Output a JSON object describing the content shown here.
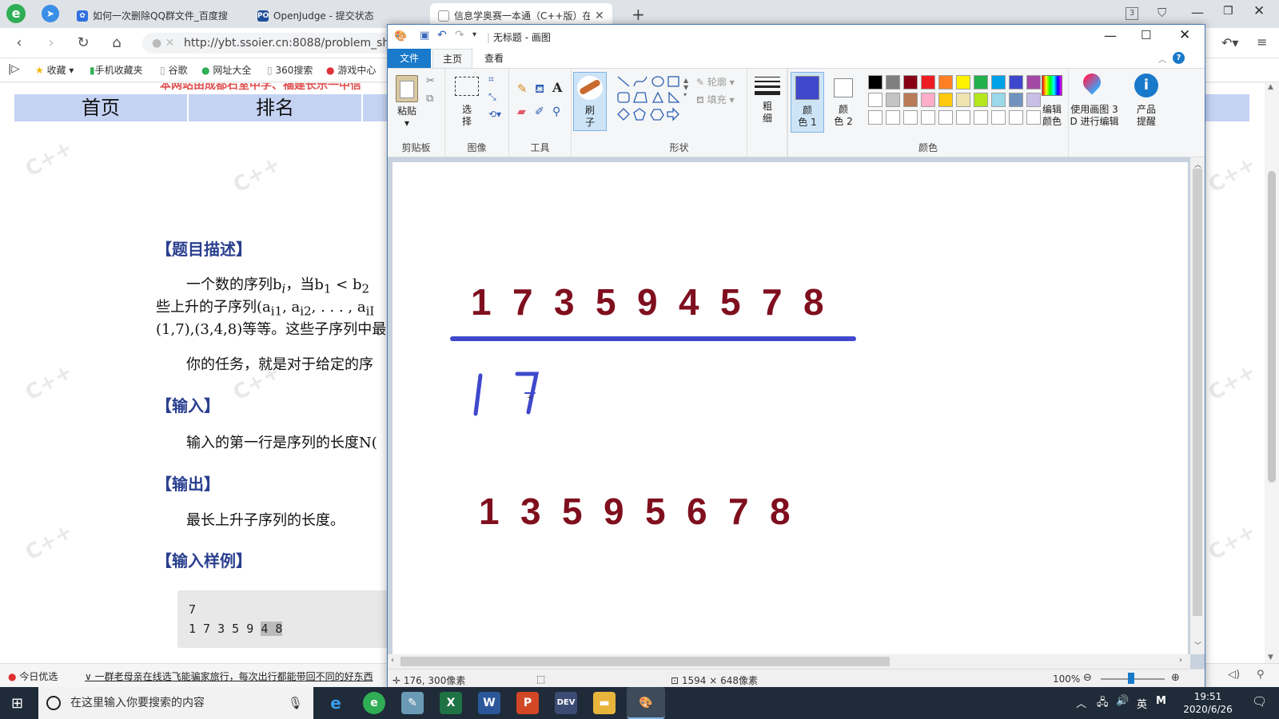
{
  "browser": {
    "tabs": [
      {
        "label": "如何一次删除QQ群文件_百度搜"
      },
      {
        "label": "OpenJudge - 提交状态"
      },
      {
        "label": "信息学奥赛一本通（C++版）在"
      }
    ],
    "tab_badge": "3",
    "url": "http://ybt.ssoier.cn:8088/problem_sho",
    "favorites": [
      "收藏",
      "手机收藏夹",
      "谷歌",
      "网址大全",
      "360搜索",
      "游戏中心"
    ]
  },
  "webpage": {
    "banner_text": "本网站由成都石室中学、福建长乐一中信",
    "menu": [
      "首页",
      "排名"
    ],
    "watermark": "C++",
    "sections": {
      "desc_title": "【题目描述】",
      "desc_line1": "一个数的序列b",
      "desc_line1_sub": "i",
      "desc_line1_rest": "，当b",
      "desc_line1_b1": "1",
      "desc_line1_lt": " < b",
      "desc_line1_b2": "2",
      "desc_line2": "些上升的子序列(a",
      "desc_line2_s1": "i1",
      "desc_line2_mid": ", a",
      "desc_line2_s2": "i2",
      "desc_line2_rest": ", . . . , a",
      "desc_line2_s3": "iI",
      "desc_line3": "(1,7),(3,4,8)等等。这些子序列中最",
      "task_line": "你的任务，就是对于给定的序",
      "input_title": "【输入】",
      "input_text": "输入的第一行是序列的长度N(",
      "output_title": "【输出】",
      "output_text": "最长上升子序列的长度。",
      "sample_title": "【输入样例】",
      "sample_line1": "7",
      "sample_line2_plain": "1 7 3 5 9 ",
      "sample_line2_hl": "4 8"
    },
    "status_left": "今日优选",
    "status_news": "一群老母亲在线选飞能骗家旅行，每次出行都能带回不同的好东西"
  },
  "paint": {
    "title": "无标题 - 画图",
    "tabs": [
      "文件",
      "主页",
      "查看"
    ],
    "ribbon": {
      "clipboard": {
        "paste": "粘贴",
        "group": "剪贴板"
      },
      "image": {
        "select": "选\n择",
        "group": "图像"
      },
      "tools": {
        "group": "工具"
      },
      "brush": {
        "label": "刷\n子"
      },
      "shapes": {
        "outline": "轮廓",
        "fill": "填充",
        "group": "形状"
      },
      "size": {
        "label": "粗\n细"
      },
      "color1": {
        "label": "颜\n色 1",
        "value": "#3f48cc"
      },
      "color2": {
        "label": "颜\n色 2",
        "value": "#ffffff"
      },
      "edit_colors": "编辑\n颜色",
      "paint3d": "使用画图 3\nD 进行编辑",
      "product_alert": "产品\n提醒",
      "colors_group": "颜色",
      "palette_row1": [
        "#000000",
        "#7f7f7f",
        "#880015",
        "#ed1c24",
        "#ff7f27",
        "#fff200",
        "#22b14c",
        "#00a2e8",
        "#3f48cc",
        "#a349a4"
      ],
      "palette_row2": [
        "#ffffff",
        "#c3c3c3",
        "#b97a57",
        "#ffaec9",
        "#ffc90e",
        "#efe4b0",
        "#b5e61d",
        "#99d9ea",
        "#7092be",
        "#c8bfe7"
      ]
    },
    "canvas": {
      "sequence_top": [
        "1",
        "7",
        "3",
        "5",
        "9",
        "4",
        "5",
        "7",
        "8"
      ],
      "handwritten": [
        "1",
        "7"
      ],
      "sequence_bottom": [
        "1",
        "3",
        "5",
        "9",
        "5",
        "6",
        "7",
        "8"
      ],
      "text_color": "#7f0f1e",
      "line_color": "#3f48cc"
    },
    "status": {
      "cursor": "176, 300像素",
      "size": "1594 × 648像素",
      "zoom": "100%"
    }
  },
  "taskbar": {
    "search_placeholder": "在这里输入你要搜索的内容",
    "ime": "英",
    "time": "19:51",
    "date": "2020/6/26"
  }
}
